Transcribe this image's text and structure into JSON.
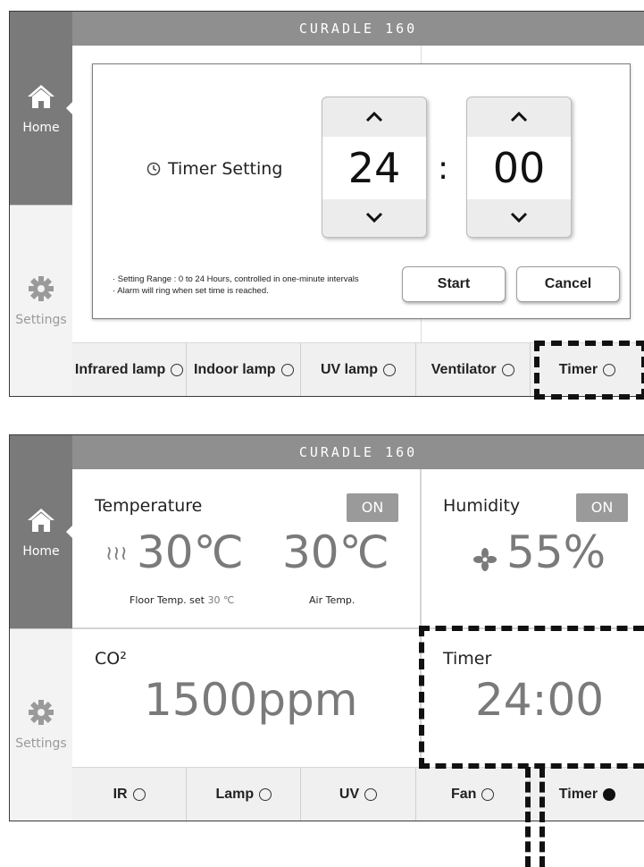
{
  "app_title": "CURADLE 160",
  "sidebar": {
    "home_label": "Home",
    "settings_label": "Settings"
  },
  "timer_dialog": {
    "title": "Timer Setting",
    "hours": "24",
    "separator": ":",
    "minutes": "00",
    "note_line1": "· Setting Range : 0 to 24 Hours, controlled in one-minute intervals",
    "note_line2": "· Alarm will ring when set time is reached.",
    "start_label": "Start",
    "cancel_label": "Cancel",
    "up_glyph": "︿",
    "down_glyph": "﹀"
  },
  "bottom_bar_1": [
    "Infrared lamp",
    "Indoor lamp",
    "UV lamp",
    "Ventilator",
    "Timer"
  ],
  "dashboard": {
    "temperature": {
      "title": "Temperature",
      "status": "ON",
      "floor_value": "30℃",
      "air_value": "30℃",
      "floor_caption": "Floor Temp. set",
      "floor_set": "30 ℃",
      "air_caption": "Air Temp."
    },
    "humidity": {
      "title": "Humidity",
      "status": "ON",
      "value": "55%"
    },
    "co2": {
      "title": "CO²",
      "value": "1500ppm"
    },
    "timer": {
      "title": "Timer",
      "value": "24:00"
    }
  },
  "bottom_bar_2": [
    "IR",
    "Lamp",
    "UV",
    "Fan",
    "Timer"
  ],
  "bottom_bar_2_active": "Timer",
  "colors": {
    "topbar": "#8f8f8f",
    "home_active": "#7a7a7a",
    "on_badge": "#9a9a9a",
    "value_text": "#7a7a7a"
  }
}
